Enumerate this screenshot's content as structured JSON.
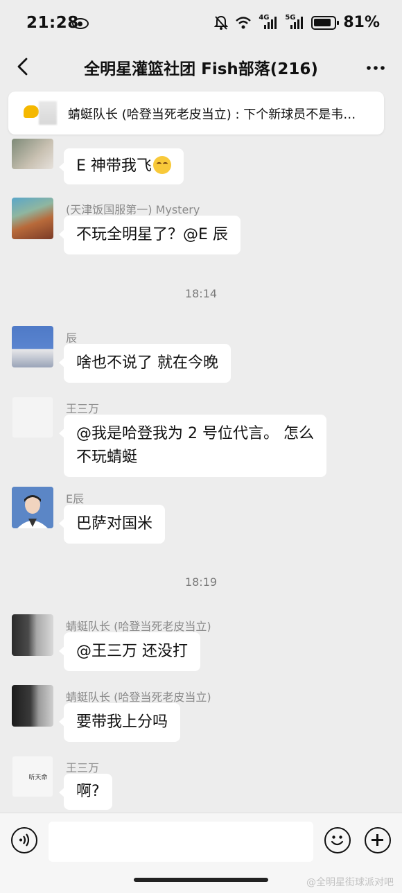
{
  "status": {
    "time": "21:28",
    "signal_1": "4G",
    "signal_2": "5G",
    "battery": "81%"
  },
  "chat": {
    "title": "全明星灌篮社团 Fish部落(216)",
    "back_icon": "chevron-left-icon",
    "more_icon": "more-dots-icon"
  },
  "pinned": {
    "text": "蜻蜓队长 (哈登当死老皮当立) : 下个新球员不是韦…",
    "icon": "chat-bubble-icon"
  },
  "messages": [
    {
      "sender": "",
      "text": "E 神带我飞",
      "emoji": "smirk-emoji-icon"
    },
    {
      "sender": "(天津饭国服第一) Mystery",
      "text": "不玩全明星了？@E 辰"
    },
    {
      "sender": "辰",
      "text": "啥也不说了 就在今晚"
    },
    {
      "sender": "王三万",
      "text_line1": "@我是哈登我为 2 号位代言。 怎么",
      "text_line2": "不玩蜻蜓"
    },
    {
      "sender": "E辰",
      "text": "巴萨对国米"
    },
    {
      "sender": "蜻蜓队长 (哈登当死老皮当立)",
      "text": "@王三万  还没打"
    },
    {
      "sender": "蜻蜓队长 (哈登当死老皮当立)",
      "text": "要带我上分吗"
    },
    {
      "sender": "王三万",
      "text": "啊?",
      "avatar_text": "听天命"
    }
  ],
  "timestamps": [
    "18:14",
    "18:19"
  ],
  "input": {
    "placeholder": ""
  },
  "watermark": "@全明星街球派对吧"
}
